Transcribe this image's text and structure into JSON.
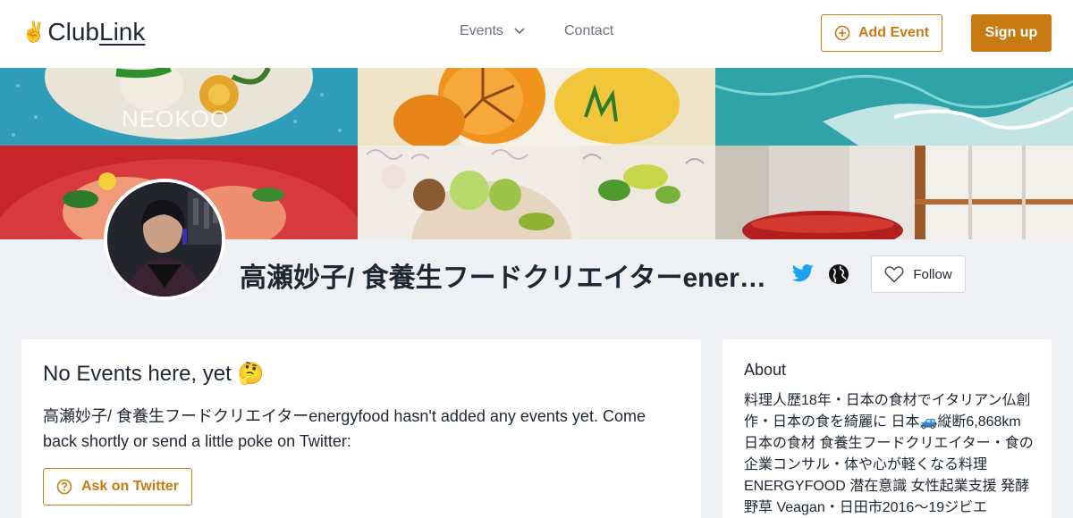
{
  "nav": {
    "logo_icon": "victory-hand-icon",
    "logo_part1": "Club",
    "logo_part2": "Link",
    "events_label": "Events",
    "contact_label": "Contact",
    "add_event_label": "Add Event",
    "signup_label": "Sign up"
  },
  "profile": {
    "name": "高瀬妙子/ 食養生フードクリエイターenergyfood",
    "follow_label": "Follow",
    "icons": [
      "twitter-icon",
      "globe-icon",
      "heart-icon"
    ]
  },
  "events_card": {
    "title": "No Events here, yet 🤔",
    "message": "高瀬妙子/ 食養生フードクリエイターenergyfood hasn't added any events yet. Come back shortly or send a little poke on Twitter:",
    "ask_label": "Ask on Twitter"
  },
  "about_card": {
    "title": "About",
    "text": "料理人歴18年・日本の食材でイタリアン仏創作・日本の食を綺麗に 日本🚙縦断6,868km 日本の食材 食養生フードクリエイター・食の企業コンサル・体や心が軽くなる料理ENERGYFOOD 潜在意識 女性起業支援 発酵 野草 Veagan・日田市2016〜19ジビエ"
  },
  "banner": {
    "watermark": "NEOKOO"
  },
  "colors": {
    "accent": "#c87a13",
    "twitter": "#1da1f2",
    "page_bg": "#eef0f3",
    "text": "#1f2733"
  }
}
